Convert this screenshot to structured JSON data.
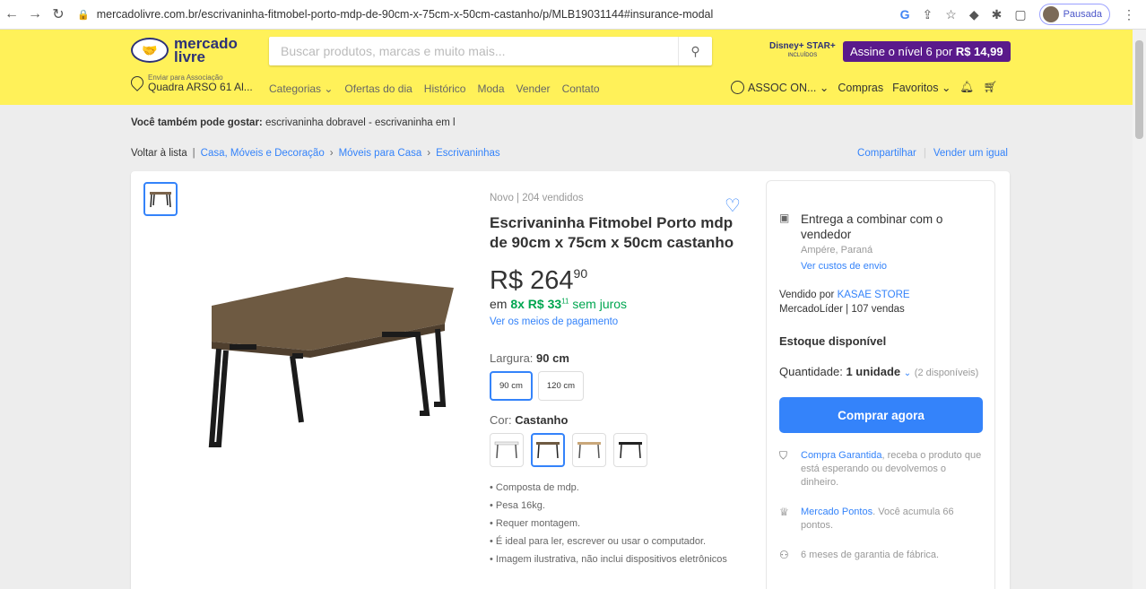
{
  "browser": {
    "url": "mercadolivre.com.br/escrivaninha-fitmobel-porto-mdp-de-90cm-x-75cm-x-50cm-castanho/p/MLB19031144#insurance-modal",
    "profile_status": "Pausada"
  },
  "header": {
    "logo_line1": "mercado",
    "logo_line2": "livre",
    "search_placeholder": "Buscar produtos, marcas e muito mais...",
    "disney_text": "Disney+ STAR+",
    "disney_sub": "INCLUÍDOS",
    "promo_text": "Assine o nível 6 por",
    "promo_price": "R$ 14,99",
    "location_label": "Enviar para Associação",
    "location_value": "Quadra ARSO 61 Al...",
    "categories": [
      "Categorias ⌄",
      "Ofertas do dia",
      "Histórico",
      "Moda",
      "Vender",
      "Contato"
    ],
    "user_label": "ASSOC ON... ⌄",
    "purchases": "Compras",
    "favorites": "Favoritos ⌄"
  },
  "recommend": {
    "label": "Você também pode gostar:",
    "text": "escrivaninha dobravel - escrivaninha em l"
  },
  "breadcrumb": {
    "back": "Voltar à lista",
    "items": [
      "Casa, Móveis e Decoração",
      "›",
      "Móveis para Casa",
      "›",
      "Escrivaninhas"
    ],
    "share": "Compartilhar",
    "sell": "Vender um igual"
  },
  "product": {
    "condition": "Novo  |  204 vendidos",
    "title": "Escrivaninha Fitmobel Porto mdp de 90cm x 75cm x 50cm castanho",
    "price_currency": "R$",
    "price_int": "264",
    "price_cents": "90",
    "install_prefix": "em",
    "install_value": "8x R$ 33",
    "install_cents": "11",
    "install_suffix": "sem juros",
    "payment_link": "Ver os meios de pagamento",
    "width_label": "Largura:",
    "width_value": "90 cm",
    "sizes": [
      "90 cm",
      "120 cm"
    ],
    "color_label": "Cor:",
    "color_value": "Castanho",
    "features": [
      "Composta de mdp.",
      "Pesa 16kg.",
      "Requer montagem.",
      "É ideal para ler, escrever ou usar o computador.",
      "Imagem ilustrativa, não inclui dispositivos eletrônicos"
    ]
  },
  "buybox": {
    "ship_title": "Entrega a combinar com o vendedor",
    "ship_location": "Ampére, Paraná",
    "ship_link": "Ver custos de envio",
    "sold_by": "Vendido por",
    "seller": "KASAE STORE",
    "seller_info": "MercadoLíder  |  107 vendas",
    "stock_title": "Estoque disponível",
    "qty_label": "Quantidade:",
    "qty_value": "1 unidade",
    "qty_avail": "(2 disponíveis)",
    "buy_label": "Comprar agora",
    "guarantee_link": "Compra Garantida",
    "guarantee_text": ", receba o produto que está esperando ou devolvemos o dinheiro.",
    "points_link": "Mercado Pontos",
    "points_text": ". Você acumula 66 pontos.",
    "warranty": "6 meses de garantia de fábrica."
  },
  "colors": {
    "brand_yellow": "#fff159",
    "accent_blue": "#3483fa",
    "green": "#00a650",
    "promo_purple": "#5a1a8b"
  }
}
